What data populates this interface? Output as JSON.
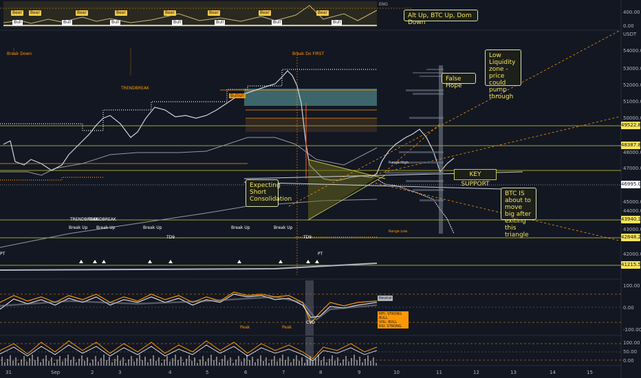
{
  "top_strip": {
    "bear_label": "Bear",
    "bull_label": "Bull",
    "eng_label": "ENG",
    "y_labels": [
      "400.00",
      "0.00"
    ]
  },
  "callouts": {
    "alt_up": "Alt Up, BTC Up, Dom Down",
    "false_hope": "False Hope",
    "low_liquidity": "Low Liquidity zone - price could pump through",
    "key_support": "KEY SUPPORT",
    "expecting": "Expecting Short Consolidation",
    "btc_big_move": "BTC IS about to move big after exiting this triangle"
  },
  "price_axis": {
    "currency": "USDT",
    "labels": [
      "54000.00",
      "53000.00",
      "52000.00",
      "51000.00",
      "50000.00",
      "48000.00",
      "47000.00",
      "45000.00",
      "44000.00",
      "43000.00",
      "42000.00"
    ],
    "tags": [
      {
        "text": "49522.82",
        "color": "#f5e45a"
      },
      {
        "text": "48387.81",
        "color": "#f5e45a"
      },
      {
        "text": "46995.00",
        "color": "#ffffff"
      },
      {
        "text": "43940.16",
        "color": "#f5e45a"
      },
      {
        "text": "42848.24",
        "color": "#f5e45a"
      },
      {
        "text": "41215.58",
        "color": "#f5e45a"
      }
    ]
  },
  "chart_annotations": {
    "break_down": "Break Down",
    "trendbreak": "TRENDBREAK",
    "break_down_first": "Break Do FIRST",
    "break_up": "Break Up",
    "trendbreak2": "TRENDBREAK",
    "td9": "TD9",
    "pt": "PT",
    "peak": "Peak",
    "bullish_tag": "Bullish",
    "cvd": "CVD",
    "range_high": "Range High",
    "range_low": "Range Low"
  },
  "osc1": {
    "labels": [
      "100.00",
      "0.00",
      "-100.00"
    ],
    "tag": "Neutral",
    "info_lines": [
      "MFI: STRONG BULL",
      "VOL: BULL",
      "RSI: STRONG BULL"
    ]
  },
  "osc2": {
    "labels": [
      "100.00",
      "50.00",
      "0.00"
    ]
  },
  "time_axis": [
    "31",
    "Sep",
    "2",
    "3",
    "4",
    "5",
    "6",
    "7",
    "8",
    "9",
    "10",
    "11",
    "12",
    "13",
    "14",
    "15"
  ]
}
